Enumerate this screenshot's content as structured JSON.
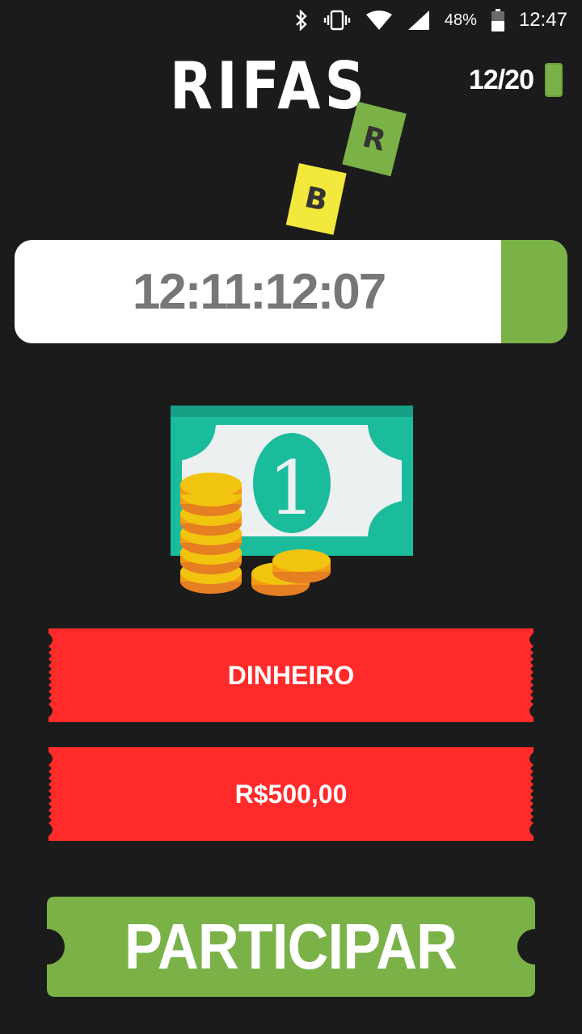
{
  "status_bar": {
    "battery_percent": "48%",
    "time": "12:47",
    "icons": [
      "bluetooth-icon",
      "vibrate-icon",
      "wifi-icon",
      "signal-icon",
      "battery-icon"
    ]
  },
  "header": {
    "logo_text": "RIFAS",
    "logo_letters": [
      "B",
      "R"
    ],
    "counter": "12/20"
  },
  "timer": {
    "value": "12:11:12:07",
    "progress_fraction": 0.12
  },
  "prize": {
    "image": "money-icon",
    "category": "DINHEIRO",
    "amount": "R$500,00"
  },
  "action": {
    "participate_label": "PARTICIPAR"
  },
  "colors": {
    "background": "#1b1b1b",
    "accent_green": "#7ab247",
    "ticket_red": "#ff2a2a",
    "logo_yellow": "#f3e83c"
  }
}
